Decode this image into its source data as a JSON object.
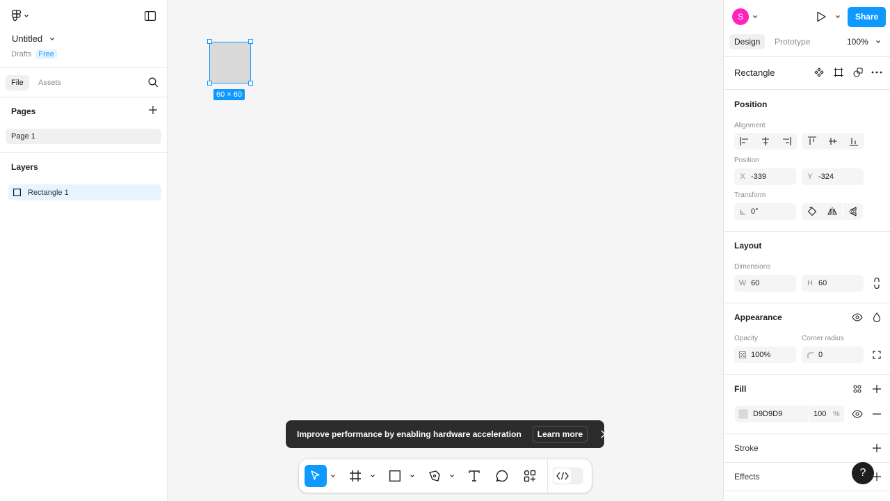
{
  "left_panel": {
    "file_name": "Untitled",
    "location": "Drafts",
    "plan_badge": "Free",
    "tabs": [
      "File",
      "Assets"
    ],
    "pages_heading": "Pages",
    "pages": [
      "Page 1"
    ],
    "layers_heading": "Layers",
    "layers": [
      "Rectangle 1"
    ]
  },
  "canvas": {
    "selection_size_label": "60 × 60",
    "shape_fill": "#D9D9D9",
    "selection_color": "#0D99FF"
  },
  "toast": {
    "message": "Improve performance by enabling hardware acceleration",
    "action_label": "Learn more"
  },
  "toolbar": {
    "tools": [
      "move-tool",
      "frame-tool",
      "rectangle-tool",
      "pen-tool",
      "text-tool",
      "comment-tool",
      "actions-tool"
    ],
    "active_tool": "move-tool",
    "dev_mode": "off"
  },
  "right_panel": {
    "avatar_initial": "S",
    "avatar_color": "#FF24BD",
    "share_label": "Share",
    "tabs": [
      "Design",
      "Prototype"
    ],
    "zoom": "100%",
    "object_title": "Rectangle",
    "position": {
      "heading": "Position",
      "alignment_label": "Alignment",
      "position_label": "Position",
      "x_prefix": "X",
      "x": "-339",
      "y_prefix": "Y",
      "y": "-324",
      "transform_label": "Transform",
      "rotation": "0°"
    },
    "layout": {
      "heading": "Layout",
      "dimensions_label": "Dimensions",
      "w_prefix": "W",
      "w": "60",
      "h_prefix": "H",
      "h": "60"
    },
    "appearance": {
      "heading": "Appearance",
      "opacity_label": "Opacity",
      "opacity": "100%",
      "corner_radius_label": "Corner radius",
      "corner_radius": "0"
    },
    "fill": {
      "heading": "Fill",
      "hex": "D9D9D9",
      "opacity": "100",
      "unit": "%"
    },
    "stroke_heading": "Stroke",
    "effects_heading": "Effects",
    "help_label": "?"
  },
  "colors": {
    "accent": "#0D99FF",
    "toast_bg": "#2C2C2C"
  }
}
